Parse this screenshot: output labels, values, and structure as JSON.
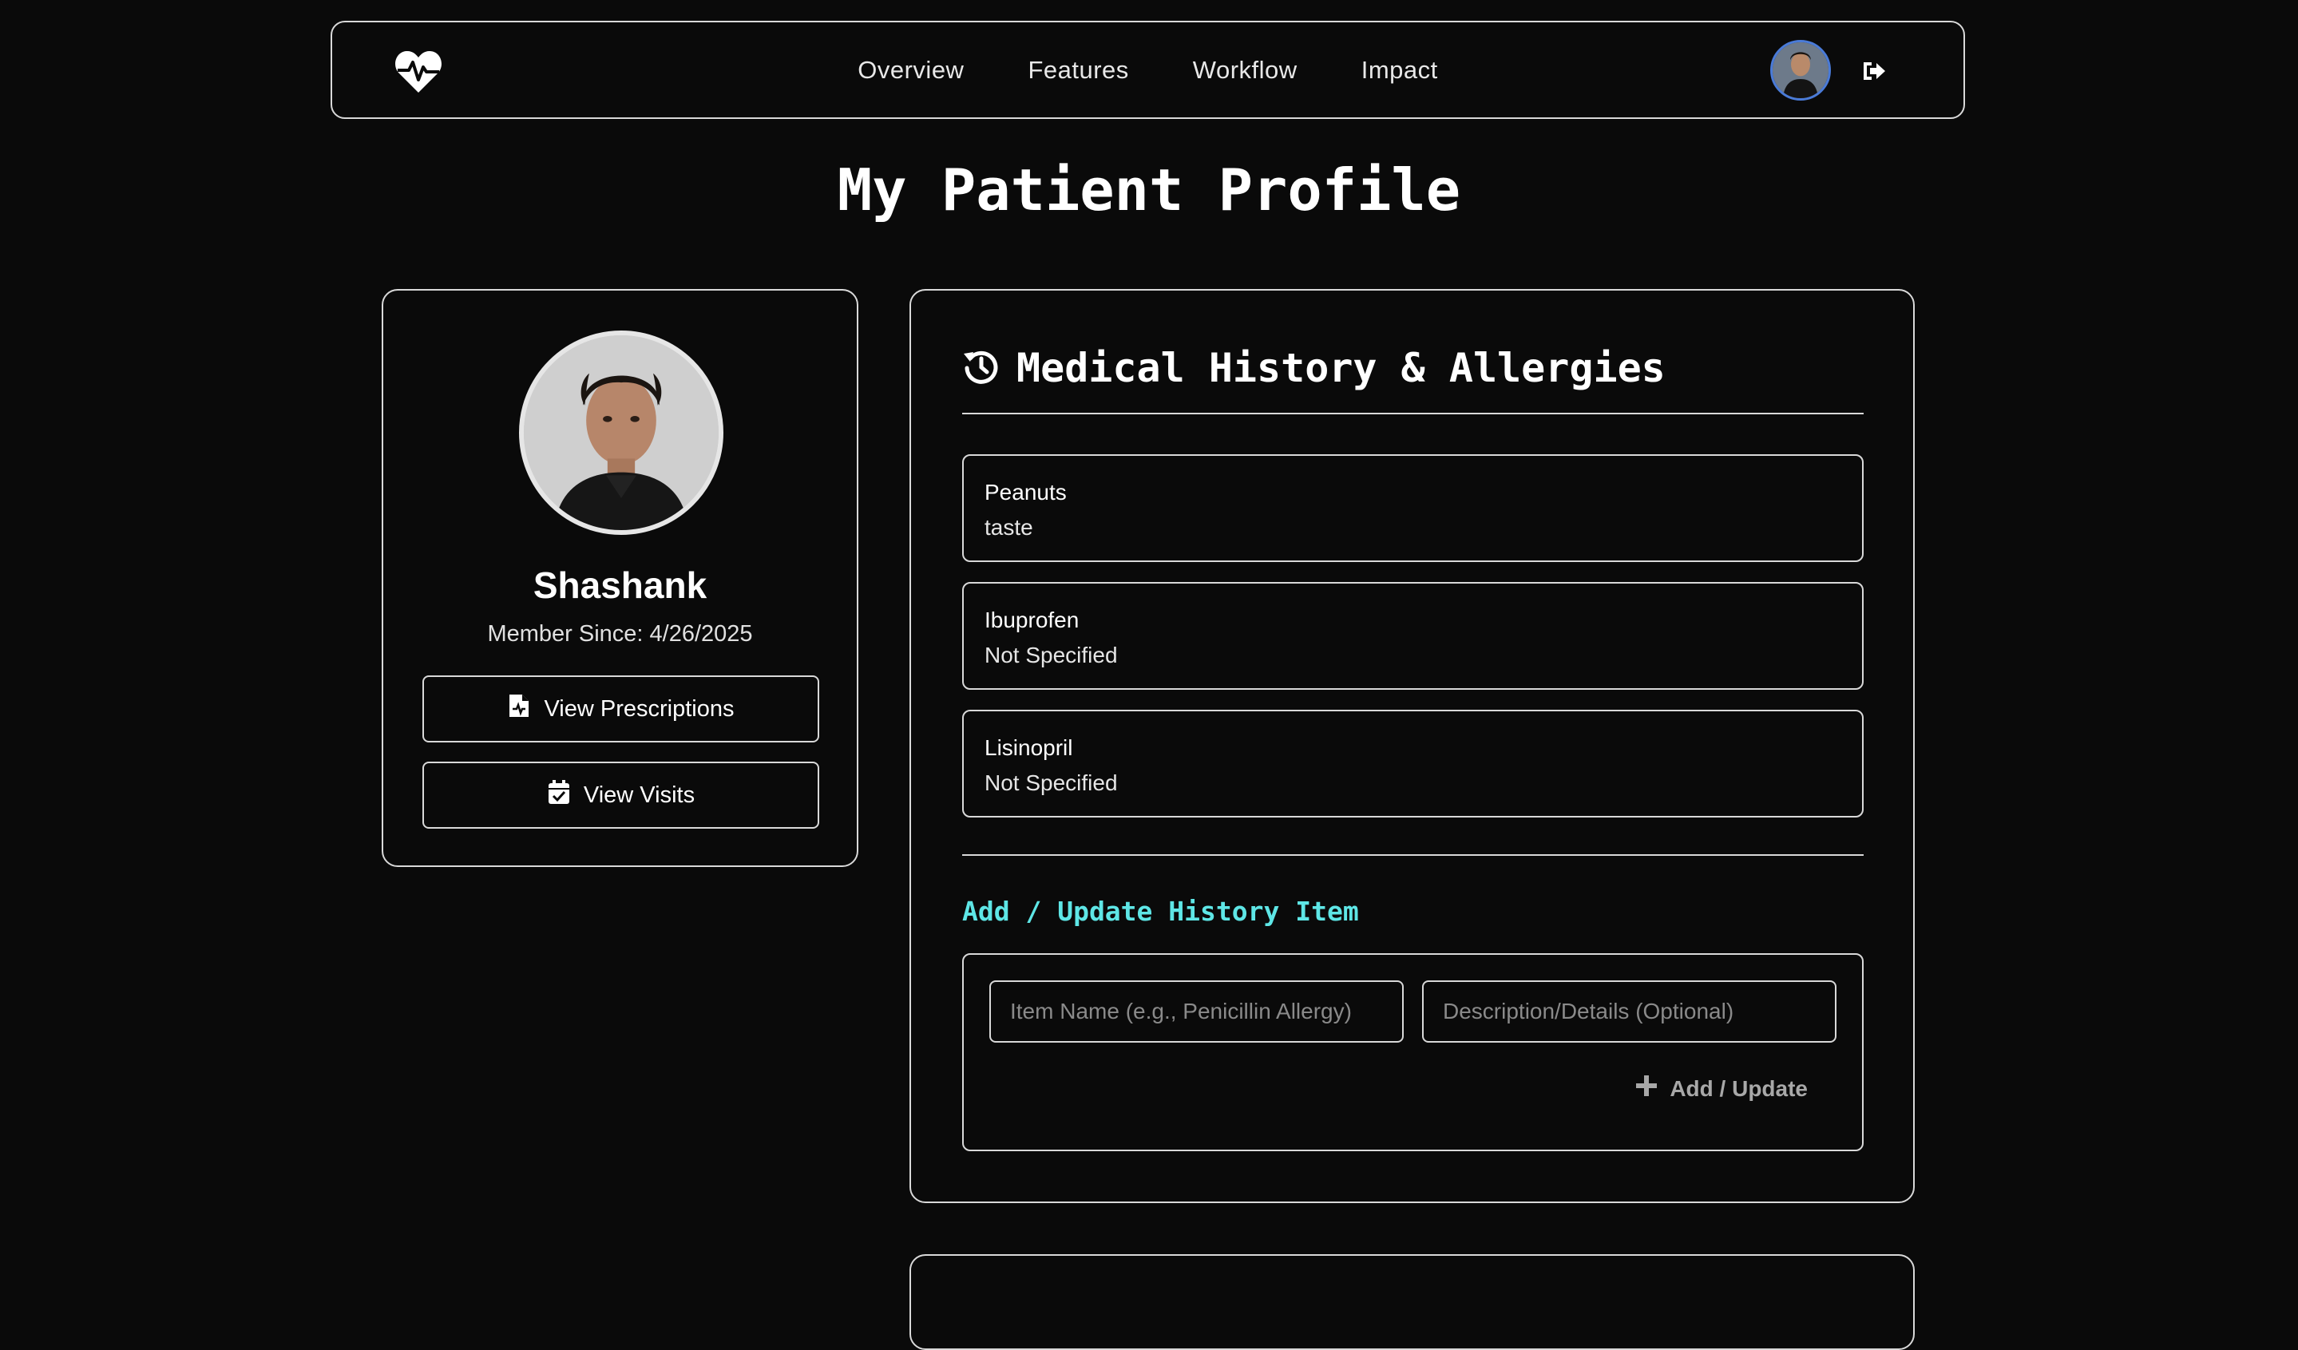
{
  "nav": {
    "logo_icon": "heart-pulse-icon",
    "links": [
      {
        "label": "Overview"
      },
      {
        "label": "Features"
      },
      {
        "label": "Workflow"
      },
      {
        "label": "Impact"
      }
    ],
    "avatar_icon": "user-avatar",
    "logout_icon": "logout-icon"
  },
  "page": {
    "title": "My Patient Profile"
  },
  "profile": {
    "name": "Shashank",
    "member_since": "Member Since: 4/26/2025",
    "buttons": {
      "prescriptions": {
        "label": "View Prescriptions",
        "icon": "prescription-file-icon"
      },
      "visits": {
        "label": "View Visits",
        "icon": "calendar-check-icon"
      }
    }
  },
  "history": {
    "title": "Medical History & Allergies",
    "icon": "history-icon",
    "items": [
      {
        "name": "Peanuts",
        "description": "taste"
      },
      {
        "name": "Ibuprofen",
        "description": "Not Specified"
      },
      {
        "name": "Lisinopril",
        "description": "Not Specified"
      }
    ],
    "add_form": {
      "title": "Add / Update History Item",
      "item_placeholder": "Item Name (e.g., Penicillin Allergy)",
      "desc_placeholder": "Description/Details (Optional)",
      "submit_label": "Add / Update",
      "submit_icon": "plus-icon"
    }
  },
  "colors": {
    "background": "#0a0a0a",
    "border": "#d9d9d9",
    "accent": "#5ee6e6",
    "avatar_ring": "#4a7bd8"
  }
}
